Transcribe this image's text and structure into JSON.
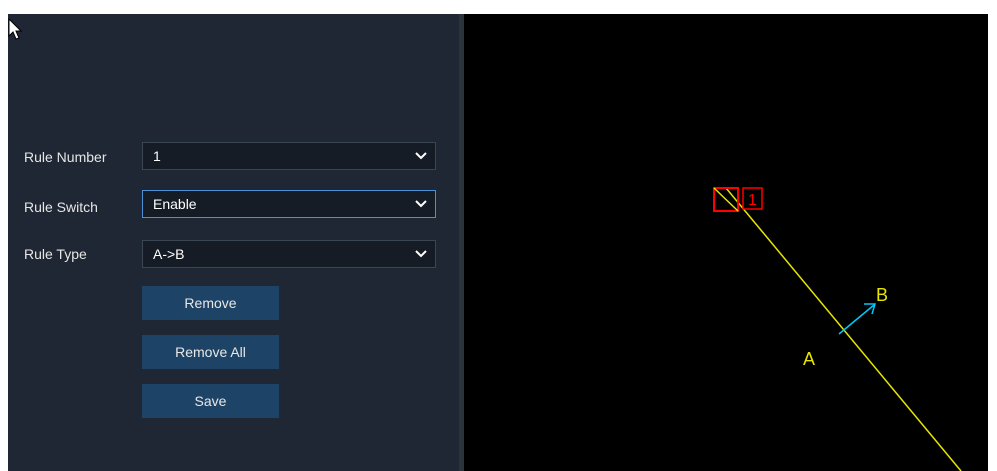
{
  "form": {
    "rule_number": {
      "label": "Rule Number",
      "value": "1"
    },
    "rule_switch": {
      "label": "Rule Switch",
      "value": "Enable"
    },
    "rule_type": {
      "label": "Rule Type",
      "value": "A->B"
    }
  },
  "buttons": {
    "remove": "Remove",
    "remove_all": "Remove All",
    "save": "Save"
  },
  "video": {
    "rule_tag": "1",
    "side_a": "A",
    "side_b": "B"
  },
  "colors": {
    "panel_bg": "#1e2733",
    "button_bg": "#1d4466",
    "line": "#e6e600",
    "handle": "#ff0000",
    "arrow": "#00c8ff"
  }
}
